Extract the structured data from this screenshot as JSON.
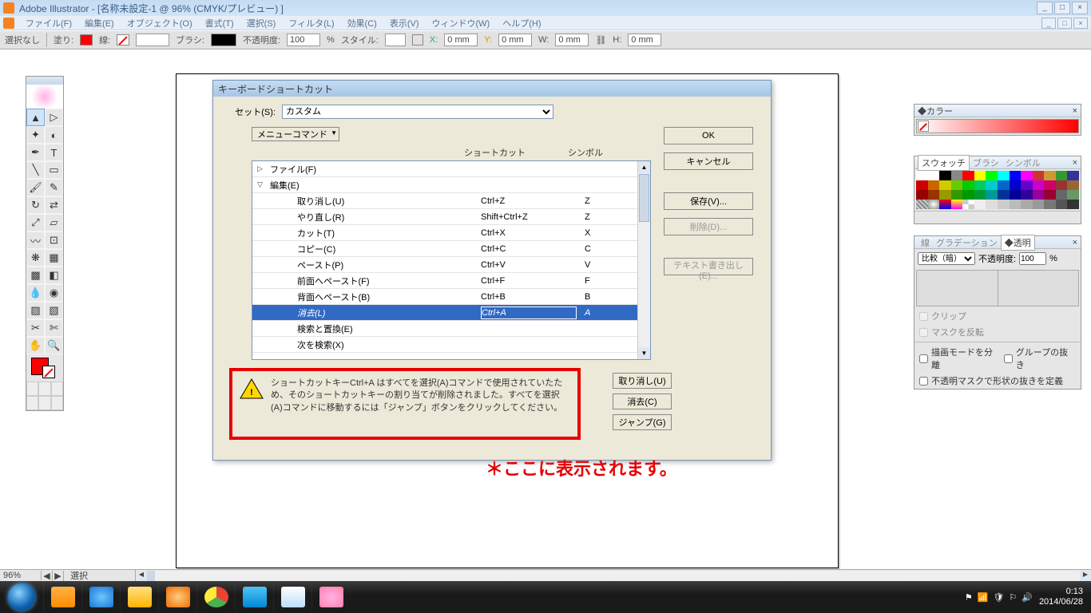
{
  "titlebar": "Adobe Illustrator - [名称未設定-1 @ 96% (CMYK/プレビュー) ]",
  "menu": [
    "ファイル(F)",
    "編集(E)",
    "オブジェクト(O)",
    "書式(T)",
    "選択(S)",
    "フィルタ(L)",
    "効果(C)",
    "表示(V)",
    "ウィンドウ(W)",
    "ヘルプ(H)"
  ],
  "optbar": {
    "sel": "選択なし",
    "fill": "塗り:",
    "stroke": "線:",
    "brush": "ブラシ:",
    "opacity": "不透明度:",
    "opval": "100",
    "pct": "%",
    "style": "スタイル:",
    "x": "X:",
    "xval": "0 mm",
    "y": "Y:",
    "yval": "0 mm",
    "w": "W:",
    "wval": "0 mm",
    "h": "H:",
    "hval": "0 mm"
  },
  "dialog": {
    "title": "キーボードショートカット",
    "set_lbl": "セット(S):",
    "set_val": "カスタム",
    "cat": "メニューコマンド",
    "hdr_shortcut": "ショートカット",
    "hdr_symbol": "シンボル",
    "rows": [
      {
        "lvl": 0,
        "tri": "▷",
        "cmd": "ファイル(F)",
        "sc": "",
        "sym": ""
      },
      {
        "lvl": 0,
        "tri": "▽",
        "cmd": "編集(E)",
        "sc": "",
        "sym": ""
      },
      {
        "lvl": 2,
        "tri": "",
        "cmd": "取り消し(U)",
        "sc": "Ctrl+Z",
        "sym": "Z"
      },
      {
        "lvl": 2,
        "tri": "",
        "cmd": "やり直し(R)",
        "sc": "Shift+Ctrl+Z",
        "sym": "Z"
      },
      {
        "lvl": 2,
        "tri": "",
        "cmd": "カット(T)",
        "sc": "Ctrl+X",
        "sym": "X"
      },
      {
        "lvl": 2,
        "tri": "",
        "cmd": "コピー(C)",
        "sc": "Ctrl+C",
        "sym": "C"
      },
      {
        "lvl": 2,
        "tri": "",
        "cmd": "ペースト(P)",
        "sc": "Ctrl+V",
        "sym": "V"
      },
      {
        "lvl": 2,
        "tri": "",
        "cmd": "前面へペースト(F)",
        "sc": "Ctrl+F",
        "sym": "F"
      },
      {
        "lvl": 2,
        "tri": "",
        "cmd": "背面へペースト(B)",
        "sc": "Ctrl+B",
        "sym": "B"
      },
      {
        "lvl": 2,
        "tri": "",
        "cmd": "消去(L)",
        "sc": "Ctrl+A",
        "sym": "A",
        "sel": true
      },
      {
        "lvl": 2,
        "tri": "",
        "cmd": "検索と置換(E)",
        "sc": "",
        "sym": ""
      },
      {
        "lvl": 2,
        "tri": "",
        "cmd": "次を検索(X)",
        "sc": "",
        "sym": ""
      }
    ],
    "btns": {
      "ok": "OK",
      "cancel": "キャンセル",
      "save": "保存(V)...",
      "delete": "削除(D)...",
      "export": "テキスト書き出し(E)..."
    },
    "side": {
      "undo": "取り消し(U)",
      "clear": "消去(C)",
      "jump": "ジャンプ(G)"
    },
    "alert": "ショートカットキーCtrl+A はすべてを選択(A)コマンドで使用されていたため、そのショートカットキーの割り当てが削除されました。すべてを選択(A)コマンドに移動するには「ジャンプ」ボタンをクリックしてください。"
  },
  "callout": "＊ここに表示されます。",
  "panels": {
    "color": "◆カラー",
    "swatch": "スウォッチ",
    "brush": "ブラシ",
    "symbol": "シンボル",
    "stroke": "線",
    "grad": "グラデーション",
    "trans": "◆透明",
    "blend": "比較（暗）",
    "oplabel": "不透明度:",
    "opval": "100",
    "pct": "%",
    "clip": "クリップ",
    "invmask": "マスクを反転",
    "iso": "描画モードを分離",
    "knock": "グループの抜き",
    "defopac": "不透明マスクで形状の抜きを定義"
  },
  "status": {
    "zoom": "96%",
    "sel": "選択"
  },
  "taskbar": {
    "time": "0:13",
    "date": "2014/06/28"
  }
}
